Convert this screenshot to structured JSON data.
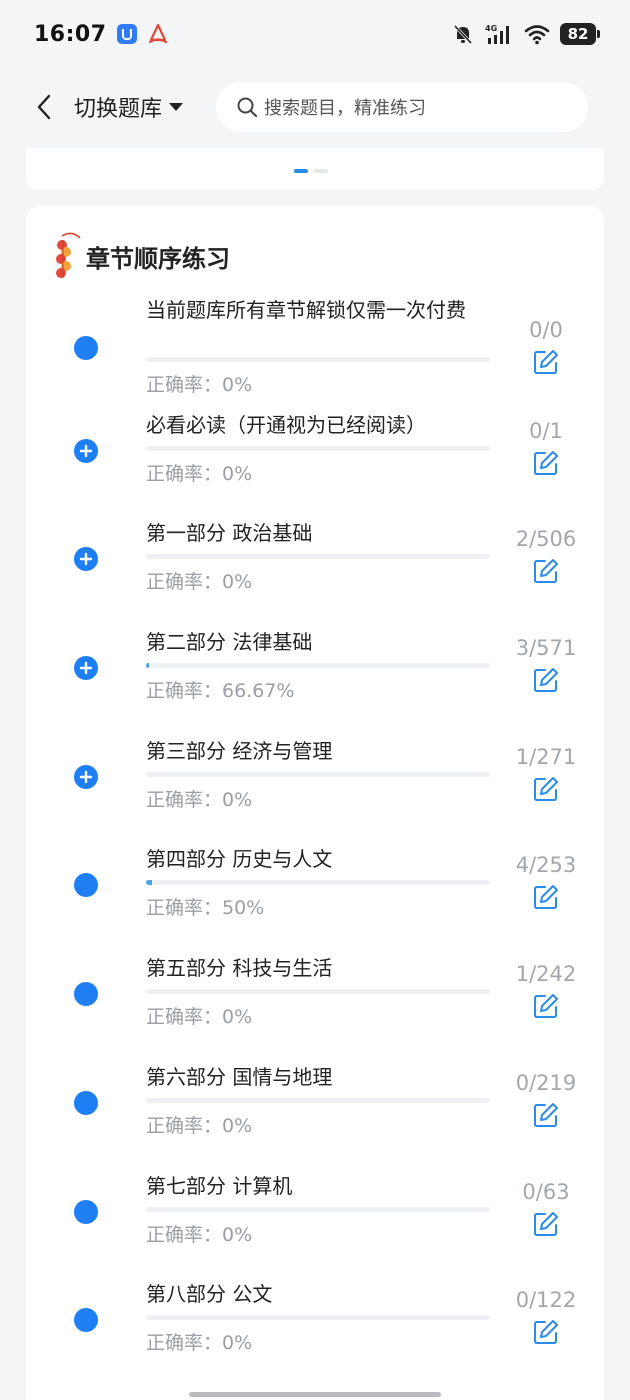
{
  "status_bar": {
    "time": "16:07",
    "network": "4G",
    "battery": "82"
  },
  "header": {
    "switch_label": "切换题库",
    "search_placeholder": "搜索题目，精准练习"
  },
  "section": {
    "title": "章节顺序练习"
  },
  "chapters": [
    {
      "name": "当前题库所有章节解锁仅需一次付费",
      "accuracy": "正确率：0%",
      "count": "0/0",
      "progress": 0,
      "icon": "dot",
      "multiline": true
    },
    {
      "name": "必看必读（开通视为已经阅读）",
      "accuracy": "正确率：0%",
      "count": "0/1",
      "progress": 0,
      "icon": "plus",
      "multiline": false
    },
    {
      "name": "第一部分 政治基础",
      "accuracy": "正确率：0%",
      "count": "2/506",
      "progress": 0,
      "icon": "plus",
      "multiline": false
    },
    {
      "name": "第二部分 法律基础",
      "accuracy": "正确率：66.67%",
      "count": "3/571",
      "progress": 0.005,
      "icon": "plus",
      "multiline": false
    },
    {
      "name": "第三部分 经济与管理",
      "accuracy": "正确率：0%",
      "count": "1/271",
      "progress": 0,
      "icon": "plus",
      "multiline": false
    },
    {
      "name": "第四部分 历史与人文",
      "accuracy": "正确率：50%",
      "count": "4/253",
      "progress": 0.016,
      "icon": "dot",
      "multiline": false
    },
    {
      "name": "第五部分 科技与生活",
      "accuracy": "正确率：0%",
      "count": "1/242",
      "progress": 0,
      "icon": "dot",
      "multiline": false
    },
    {
      "name": "第六部分 国情与地理",
      "accuracy": "正确率：0%",
      "count": "0/219",
      "progress": 0,
      "icon": "dot",
      "multiline": false
    },
    {
      "name": "第七部分 计算机",
      "accuracy": "正确率：0%",
      "count": "0/63",
      "progress": 0,
      "icon": "dot",
      "multiline": false
    },
    {
      "name": "第八部分 公文",
      "accuracy": "正确率：0%",
      "count": "0/122",
      "progress": 0,
      "icon": "dot",
      "multiline": false
    }
  ],
  "colors": {
    "accent": "#1e7ff5",
    "progress": "#4aa4e8",
    "edit_icon": "#2b8ce8"
  }
}
